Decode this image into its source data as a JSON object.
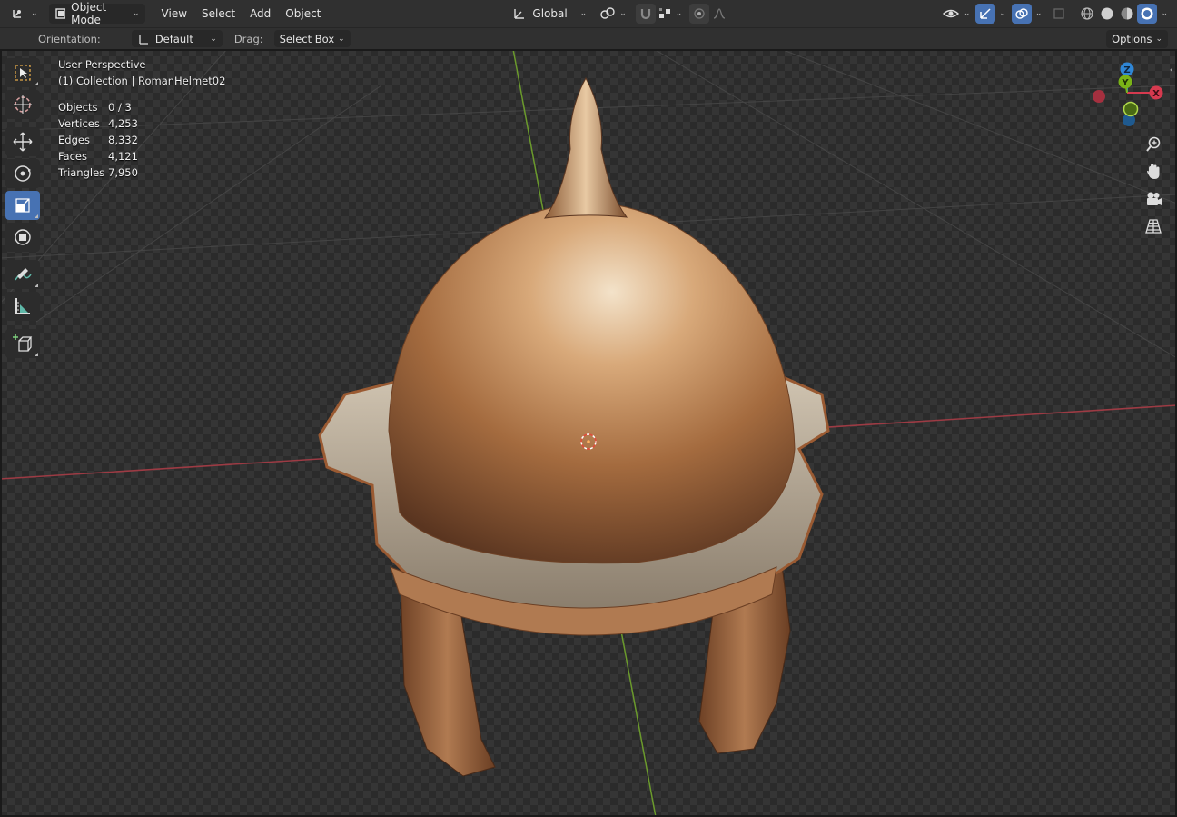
{
  "header": {
    "editor_type_icon": "axes-editor-icon",
    "mode_label": "Object Mode",
    "menus": [
      "View",
      "Select",
      "Add",
      "Object"
    ],
    "transform_orientation": "Global"
  },
  "tool_settings": {
    "orientation_label": "Orientation:",
    "orientation_value": "Default",
    "drag_label": "Drag:",
    "drag_value": "Select Box",
    "options_label": "Options"
  },
  "viewport": {
    "view_name": "User Perspective",
    "collection_line": "(1) Collection | RomanHelmet02",
    "stats": [
      {
        "label": "Objects",
        "value": "0 / 3"
      },
      {
        "label": "Vertices",
        "value": "4,253"
      },
      {
        "label": "Edges",
        "value": "8,332"
      },
      {
        "label": "Faces",
        "value": "4,121"
      },
      {
        "label": "Triangles",
        "value": "7,950"
      }
    ],
    "gizmo": {
      "x_label": "X",
      "y_label": "Y",
      "z_label": "Z",
      "x_color": "#d63a4f",
      "y_color": "#7ab317",
      "z_color": "#2f86d6"
    }
  },
  "colors": {
    "accent": "#4772b3",
    "header_bg": "#303030",
    "x_axis_line": "#9c3b44",
    "y_axis_line": "#6b9a2c",
    "helmet_bronze": "#b57a4a"
  },
  "left_tools": [
    "select-box-tool",
    "cursor-tool",
    "move-tool",
    "rotate-tool",
    "scale-tool",
    "transform-tool",
    "annotate-tool",
    "measure-tool",
    "add-cube-tool"
  ]
}
